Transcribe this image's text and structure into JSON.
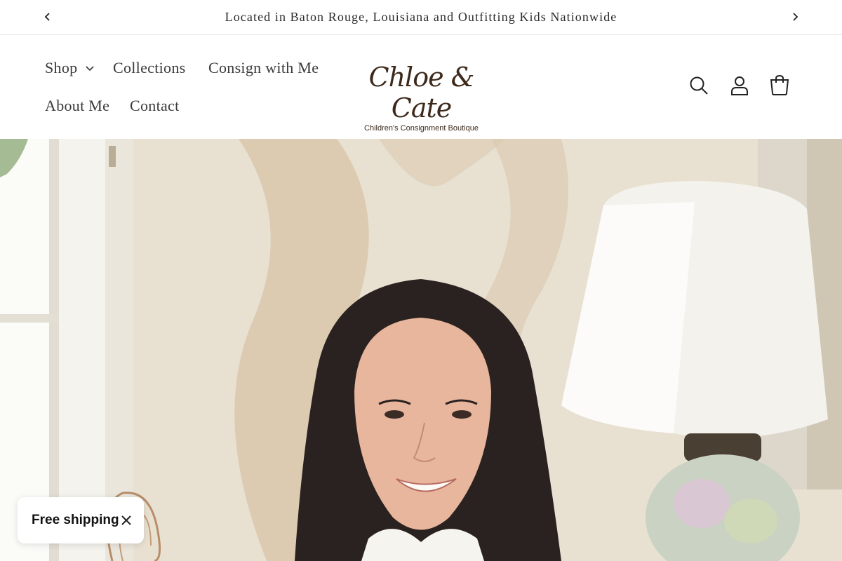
{
  "announcement": {
    "text": "Located in Baton Rouge, Louisiana and Outfitting Kids Nationwide",
    "prev_icon": "chevron-left-icon",
    "next_icon": "chevron-right-icon"
  },
  "nav": {
    "items": [
      {
        "label": "Shop",
        "has_dropdown": true
      },
      {
        "label": "Collections"
      },
      {
        "label": "Consign with Me"
      },
      {
        "label": "About Me"
      },
      {
        "label": "Contact"
      }
    ]
  },
  "logo": {
    "name": "Chloe & Cate",
    "tagline": "Children's Consignment Boutique"
  },
  "header_icons": [
    "search-icon",
    "account-icon",
    "cart-icon"
  ],
  "hero": {
    "image": "portrait-photo"
  },
  "free_shipping": {
    "label": "Free shipping",
    "close_icon": "close-icon"
  },
  "colors": {
    "text": "#2b2b2b",
    "logo": "#3d2a1c",
    "divider": "#e6e6e6"
  }
}
